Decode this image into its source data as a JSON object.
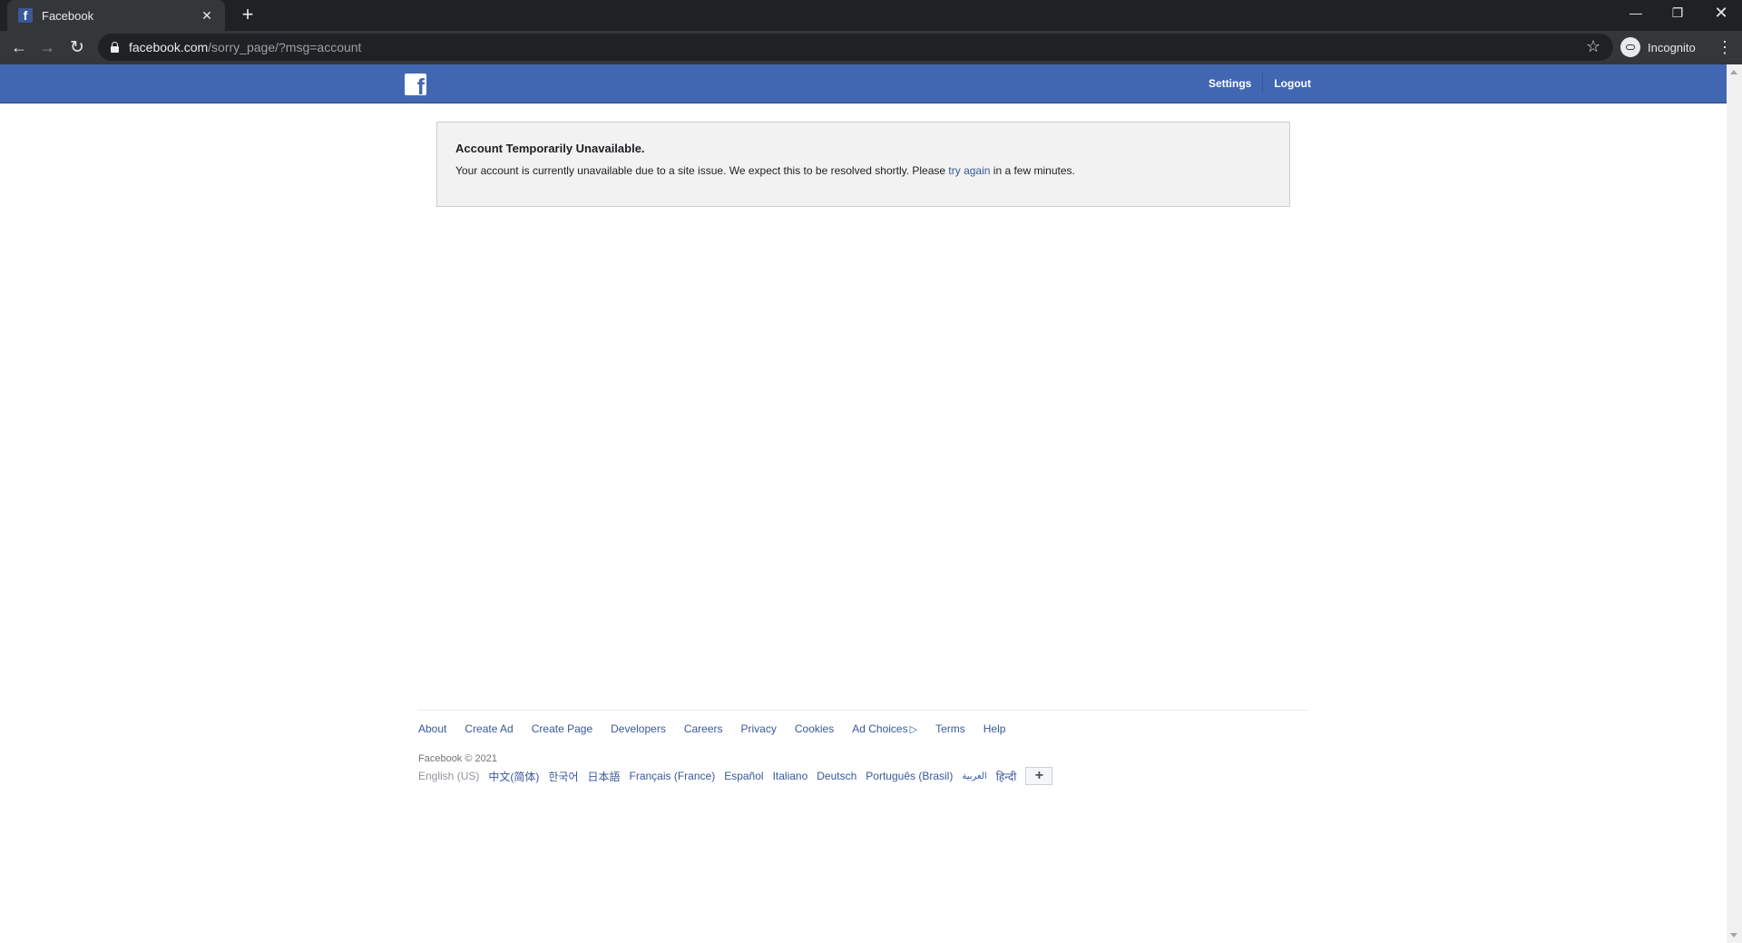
{
  "browser": {
    "tab": {
      "title": "Facebook",
      "favicon": "f",
      "close": "✕"
    },
    "new_tab": "+",
    "window_controls": {
      "minimize": "—",
      "maximize": "❐",
      "close": "✕"
    },
    "nav": {
      "back": "←",
      "forward": "→",
      "reload": "↻"
    },
    "url": {
      "host": "facebook.com",
      "path": "/sorry_page/?msg=account"
    },
    "bookmark_icon": "☆",
    "profile": {
      "label": "Incognito"
    },
    "menu_icon": "⋮"
  },
  "header": {
    "logo": "f",
    "nav": [
      {
        "label": "Settings"
      },
      {
        "label": "Logout"
      }
    ]
  },
  "notice": {
    "title": "Account Temporarily Unavailable.",
    "body_before": "Your account is currently unavailable due to a site issue. We expect this to be resolved shortly. Please ",
    "link": "try again",
    "body_after": " in a few minutes."
  },
  "footer": {
    "links": [
      {
        "label": "About"
      },
      {
        "label": "Create Ad"
      },
      {
        "label": "Create Page"
      },
      {
        "label": "Developers"
      },
      {
        "label": "Careers"
      },
      {
        "label": "Privacy"
      },
      {
        "label": "Cookies"
      },
      {
        "label": "Ad Choices",
        "icon": "▷"
      },
      {
        "label": "Terms"
      },
      {
        "label": "Help"
      }
    ],
    "copyright": "Facebook © 2021",
    "languages": [
      {
        "label": "English (US)",
        "current": true
      },
      {
        "label": "中文(简体)"
      },
      {
        "label": "한국어"
      },
      {
        "label": "日本語"
      },
      {
        "label": "Français (France)"
      },
      {
        "label": "Español"
      },
      {
        "label": "Italiano"
      },
      {
        "label": "Deutsch"
      },
      {
        "label": "Português (Brasil)"
      },
      {
        "label": "العربية"
      },
      {
        "label": "हिन्दी"
      }
    ],
    "more_languages": "+"
  }
}
